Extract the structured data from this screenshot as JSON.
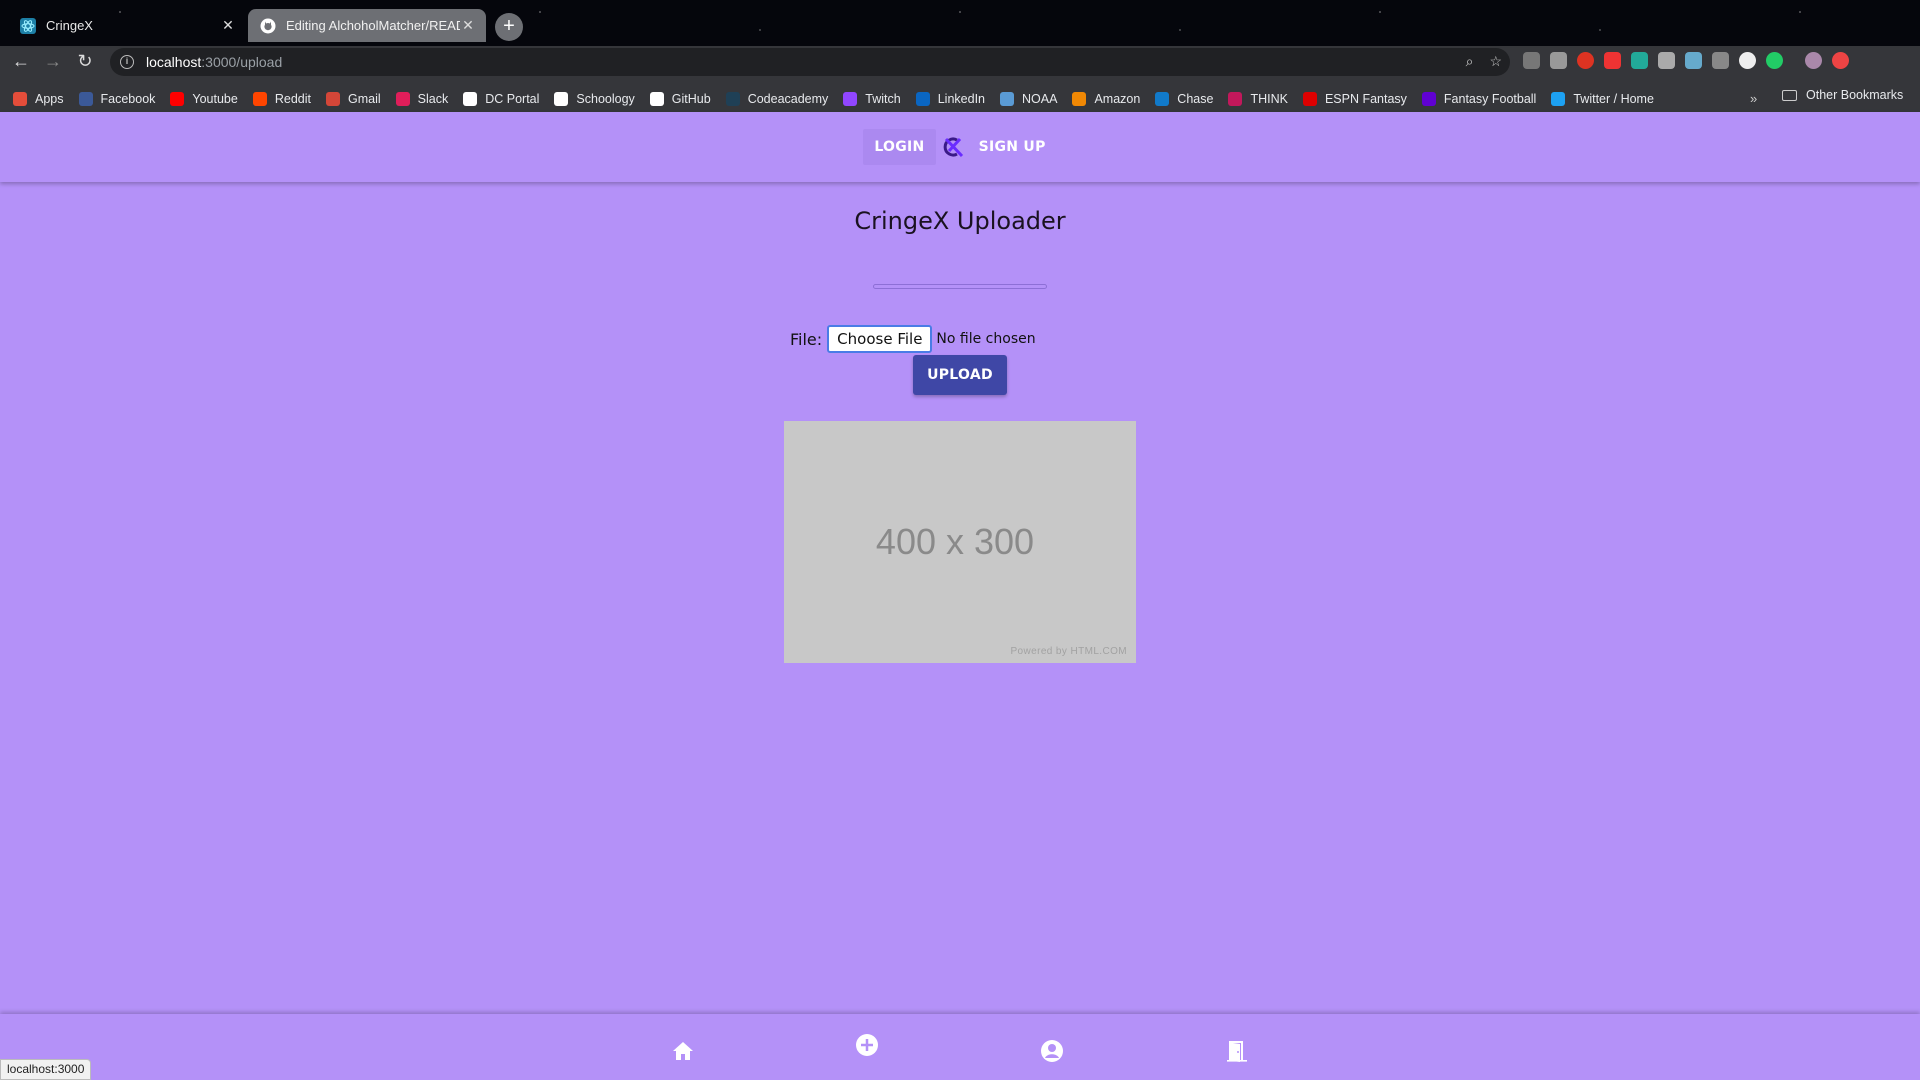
{
  "browser": {
    "tabs": [
      {
        "title": "CringeX",
        "active": true
      },
      {
        "title": "Editing AlchoholMatcher/READ",
        "active": false
      }
    ],
    "url_host": "localhost",
    "url_path": ":3000/upload",
    "bookmarks": [
      {
        "label": "Apps",
        "color": "#e44d3a"
      },
      {
        "label": "Facebook",
        "color": "#3b5998"
      },
      {
        "label": "Youtube",
        "color": "#ff0000"
      },
      {
        "label": "Reddit",
        "color": "#ff4500"
      },
      {
        "label": "Gmail",
        "color": "#d44638"
      },
      {
        "label": "Slack",
        "color": "#e01e5a"
      },
      {
        "label": "DC Portal",
        "color": "#ffffff"
      },
      {
        "label": "Schoology",
        "color": "#ffffff"
      },
      {
        "label": "GitHub",
        "color": "#ffffff"
      },
      {
        "label": "Codeacademy",
        "color": "#1f4056"
      },
      {
        "label": "Twitch",
        "color": "#9146ff"
      },
      {
        "label": "LinkedIn",
        "color": "#0a66c2"
      },
      {
        "label": "NOAA",
        "color": "#5a9bd5"
      },
      {
        "label": "Amazon",
        "color": "#f08804"
      },
      {
        "label": "Chase",
        "color": "#117aca"
      },
      {
        "label": "THINK",
        "color": "#c2185b"
      },
      {
        "label": "ESPN Fantasy",
        "color": "#d00"
      },
      {
        "label": "Fantasy Football",
        "color": "#6001d2"
      },
      {
        "label": "Twitter / Home",
        "color": "#1da1f2"
      }
    ],
    "bookmarks_more": "»",
    "other_bookmarks": "Other Bookmarks",
    "status_url": "localhost:3000"
  },
  "app": {
    "nav": {
      "login": "LOGIN",
      "signup": "SIGN UP"
    },
    "title": "CringeX Uploader",
    "upload_progress": 0,
    "file_label": "File:",
    "choose_file": "Choose File",
    "no_file": "No file chosen",
    "upload": "UPLOAD",
    "placeholder_dims": "400 x 300",
    "placeholder_powered": "Powered by HTML.COM",
    "accent": "#b491f8",
    "button_color": "#3f47a6"
  }
}
